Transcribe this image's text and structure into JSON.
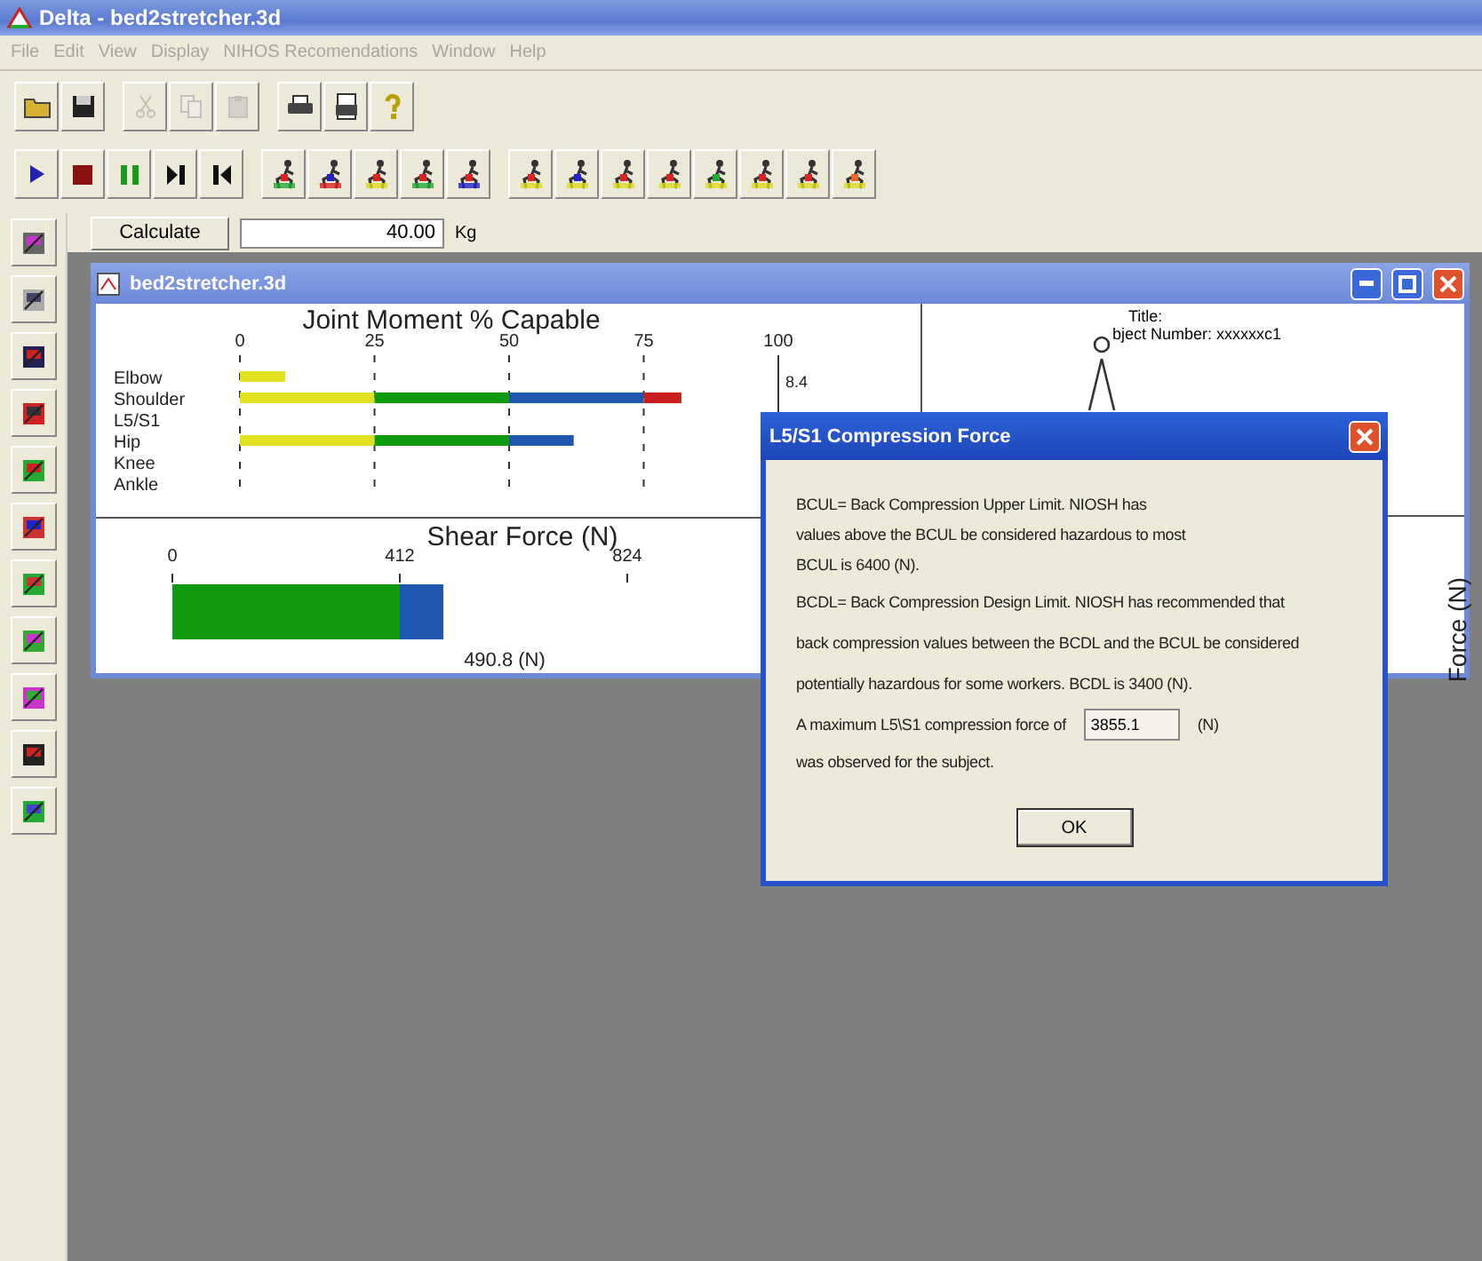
{
  "app": {
    "title": "Delta - bed2stretcher.3d"
  },
  "menu": [
    {
      "label": "File",
      "disabled": true
    },
    {
      "label": "Edit",
      "disabled": true
    },
    {
      "label": "View",
      "disabled": true
    },
    {
      "label": "Display",
      "disabled": true
    },
    {
      "label": "NIHOS Recomendations",
      "disabled": true
    },
    {
      "label": "Window",
      "disabled": true
    },
    {
      "label": "Help",
      "disabled": true
    }
  ],
  "toolbar": [
    {
      "kind": "open",
      "disabled": false
    },
    {
      "kind": "save",
      "disabled": false
    },
    {
      "kind": "sep"
    },
    {
      "kind": "cut",
      "disabled": true
    },
    {
      "kind": "copy",
      "disabled": true
    },
    {
      "kind": "paste",
      "disabled": true
    },
    {
      "kind": "sep"
    },
    {
      "kind": "print",
      "disabled": false
    },
    {
      "kind": "preview",
      "disabled": false
    },
    {
      "kind": "help",
      "disabled": false
    }
  ],
  "playback": [
    {
      "kind": "play"
    },
    {
      "kind": "stop"
    },
    {
      "kind": "pause"
    },
    {
      "kind": "end"
    },
    {
      "kind": "start"
    }
  ],
  "calc": {
    "button": "Calculate",
    "value": "40.00",
    "unit": "Kg"
  },
  "document": {
    "title": "bed2stretcher.3d",
    "moment_chart": {
      "chart_data": {
        "type": "bar",
        "title": "Joint Moment % Capable",
        "orientation": "horizontal",
        "stacked": true,
        "grid": true,
        "categories": [
          "Elbow",
          "Shoulder",
          "L5/S1",
          "Hip",
          "Knee",
          "Ankle"
        ],
        "xlim": [
          0,
          100
        ],
        "xticks": [
          0,
          25,
          50,
          75,
          100
        ],
        "series": [
          {
            "color": "#e0e020",
            "values": [
              8.4,
              25,
              null,
              25,
              null,
              null
            ]
          },
          {
            "color": "#109a10",
            "values": [
              null,
              25,
              null,
              25,
              null,
              null
            ]
          },
          {
            "color": "#1e56b0",
            "values": [
              null,
              25,
              null,
              12,
              null,
              null
            ]
          },
          {
            "color": "#c81e1e",
            "values": [
              null,
              7,
              null,
              null,
              null,
              null
            ]
          }
        ]
      },
      "side_value": "8.4"
    },
    "shear_chart": {
      "chart_data": {
        "type": "bar",
        "title": "Shear Force (N)",
        "orientation": "horizontal",
        "stacked": true,
        "xlim": [
          0,
          824
        ],
        "xticks": [
          0,
          412,
          824
        ],
        "series": [
          {
            "color": "#109a10",
            "values": [
              412
            ]
          },
          {
            "color": "#1e56b0",
            "values": [
              78.8
            ]
          }
        ]
      },
      "total": "490.8 (N)"
    },
    "subject": {
      "title": "Title:",
      "number": "bject Number: xxxxxxc1"
    },
    "force_axis": "Force (N)"
  },
  "dialog": {
    "title": "L5/S1 Compression Force",
    "lines": [
      "BCUL= Back Compression Upper Limit.  NIOSH has",
      "values above the BCUL be considered hazardous to most",
      "BCUL is 6400 (N).",
      "BCDL= Back Compression Design Limit.  NIOSH has recommended that",
      "back compression values between the BCDL and the BCUL be considered",
      "potentially hazardous for some workers.  BCDL is 3400 (N)."
    ],
    "result_prefix": "A maximum L5\\S1 compression force of",
    "result_value": "3855.1",
    "result_unit": "(N)",
    "result_suffix": "was observed for the subject.",
    "ok": "OK"
  }
}
